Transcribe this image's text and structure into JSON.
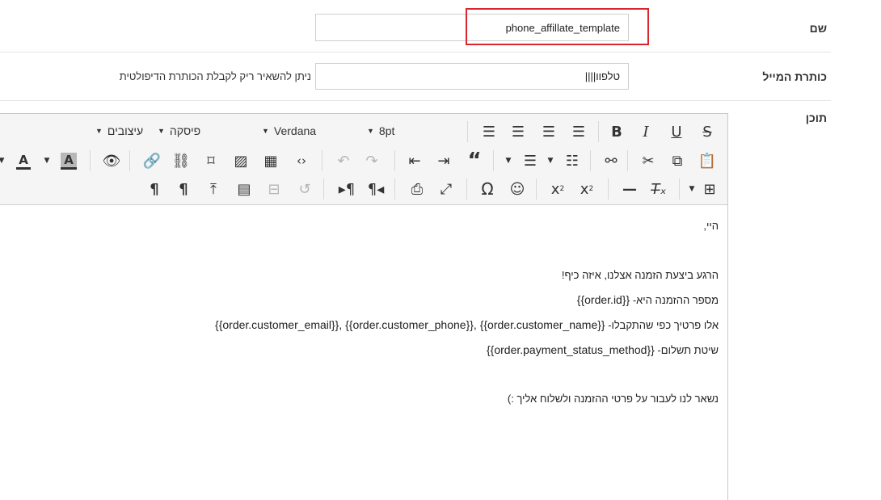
{
  "form": {
    "name_label": "שם",
    "name_value": "phone_affillate_template",
    "subject_label": "כותרת המייל",
    "subject_value": "טלפוו||||",
    "subject_hint": "ניתן להשאיר ריק לקבלת הכותרת הדיפולטית",
    "content_label": "תוכן"
  },
  "toolbar": {
    "font_size": "8pt",
    "font_family": "Verdana",
    "paragraph_format": "פיסקה",
    "styles": "עיצובים"
  },
  "icons": {
    "bold": "B",
    "italic": "I",
    "underline": "U",
    "strikethrough": "S",
    "subscript": "x",
    "subscript_mark": "2",
    "superscript": "x",
    "superscript_mark": "2",
    "omega": "Ω",
    "smiley": "☺",
    "text_color": "A",
    "bg_color": "A"
  },
  "accent": {
    "highlight_border": "#d9262c"
  },
  "content": {
    "lines": [
      {
        "pre": "היי,",
        "ltr": ""
      },
      {
        "pre": "הרגע ביצעת הזמנה אצלנו, איזה כיף!",
        "ltr": ""
      },
      {
        "pre": "מספר ההזמנה היא- ",
        "ltr": "{{order.id}}"
      },
      {
        "pre": "אלו פרטיך כפי שהתקבלו- ",
        "ltr": "{{order.customer_email}}, {{order.customer_phone}}, {{order.customer_name}}"
      },
      {
        "pre": "שיטת תשלום- ",
        "ltr": "{{order.payment_status_method}}"
      },
      {
        "pre": "נשאר לנו לעבור על פרטי ההזמנה ולשלוח אליך :)",
        "ltr": ""
      }
    ]
  }
}
